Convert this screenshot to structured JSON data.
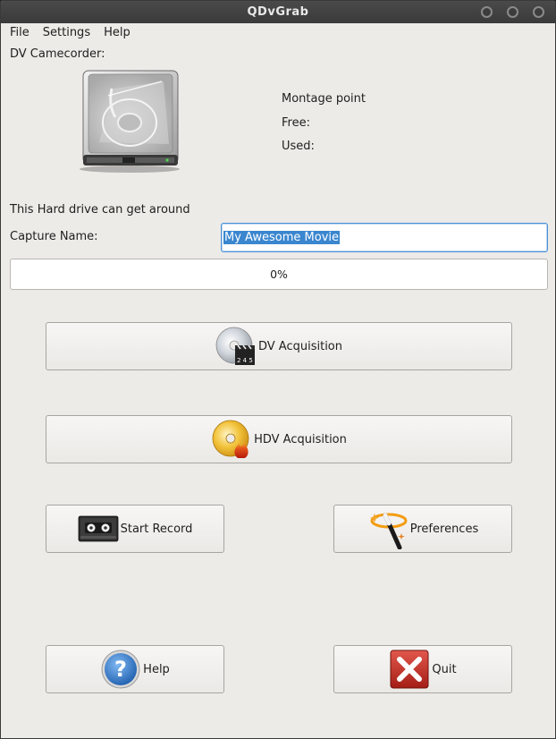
{
  "window": {
    "title": "QDvGrab"
  },
  "menu": {
    "file": "File",
    "settings": "Settings",
    "help": "Help"
  },
  "device": {
    "camcorder_label": "DV Camecorder:",
    "montage_point": "Montage point",
    "free": "Free:",
    "used": "Used:",
    "capacity_text": "This Hard drive can get around"
  },
  "capture": {
    "label": "Capture Name:",
    "value": "My Awesome Movie"
  },
  "progress": {
    "value": 0,
    "text": "0%"
  },
  "buttons": {
    "dv_acquisition": "DV Acquisition",
    "hdv_acquisition": "HDV Acquisition",
    "start_record": "Start Record",
    "preferences": "Preferences",
    "help": "Help",
    "quit": "Quit"
  },
  "colors": {
    "selection": "#3a86cf",
    "focus_border": "#4a90d9",
    "window_bg": "#edebe8"
  }
}
